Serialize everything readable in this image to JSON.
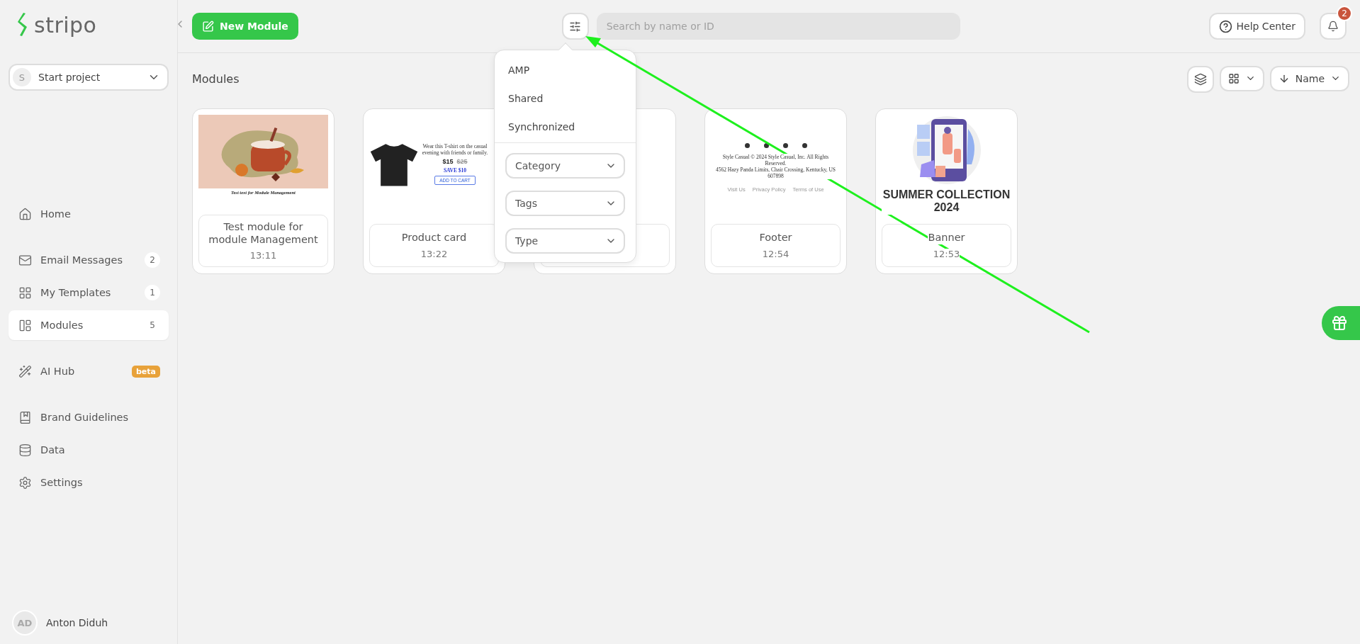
{
  "sidebar": {
    "logo": "stripo",
    "project": {
      "initial": "S",
      "name": "Start project"
    },
    "groups": [
      [
        {
          "label": "Home",
          "selected": false
        }
      ],
      [
        {
          "label": "Email Messages",
          "count": "2",
          "selected": false
        },
        {
          "label": "My Templates",
          "count": "1",
          "selected": false
        },
        {
          "label": "Modules",
          "count": "5",
          "selected": true
        }
      ],
      [
        {
          "label": "AI Hub",
          "badge": "beta",
          "selected": false
        }
      ],
      [
        {
          "label": "Brand Guidelines",
          "selected": false
        },
        {
          "label": "Data",
          "selected": false
        },
        {
          "label": "Settings",
          "selected": false
        }
      ]
    ],
    "user": {
      "initials": "AD",
      "name": "Anton Diduh"
    }
  },
  "toolbar": {
    "new_button": "New Module",
    "search": {
      "placeholder": "Search by name or ID"
    },
    "help": "Help Center",
    "notifications": "2"
  },
  "filter_menu": {
    "options": [
      "AMP",
      "Shared",
      "Synchronized"
    ],
    "selects": [
      "Category",
      "Tags",
      "Type"
    ]
  },
  "page": {
    "title": "Modules",
    "sort": "Name"
  },
  "modules": [
    {
      "kind": "picture",
      "caption": "Test text for Module Management",
      "name": "Test module for module Management",
      "time": "13:11"
    },
    {
      "kind": "product",
      "description": "Wear this T-shirt on the casual evening with friends or family.",
      "price": "$15",
      "old_price": "$25",
      "saving": "SAVE $10",
      "cta": "ADD TO CART",
      "name": "Product card",
      "time": "13:22"
    },
    {
      "kind": "covered"
    },
    {
      "kind": "footer",
      "lines": [
        "Style Casual © 2024 Style Casual, Inc. All Rights Reserved.",
        "4562 Hazy Panda Limits, Chair Crossing, Kentucky, US 607898"
      ],
      "links": [
        "Visit Us",
        "Privacy Policy",
        "Terms of Use"
      ],
      "name": "Footer",
      "time": "12:54"
    },
    {
      "kind": "banner",
      "headline": "SUMMER COLLECTION 2024",
      "name": "Banner",
      "time": "12:53"
    }
  ]
}
